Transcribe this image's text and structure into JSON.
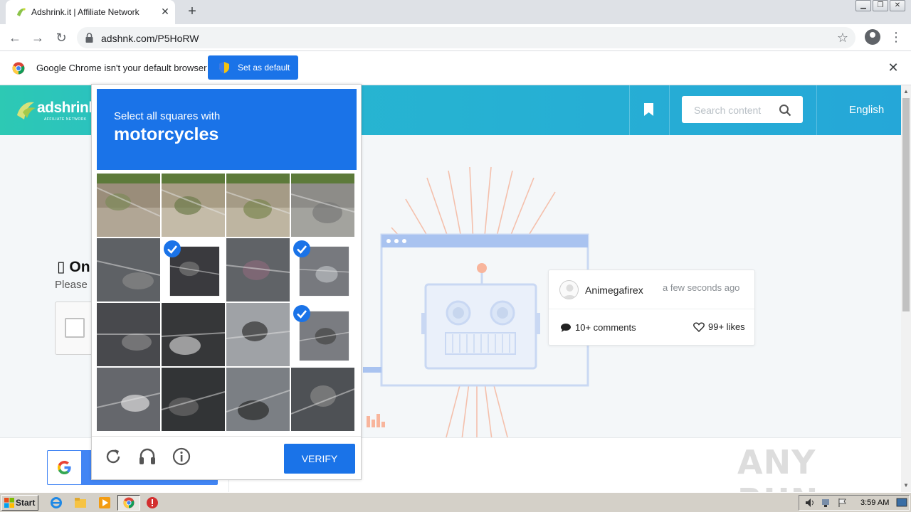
{
  "browser": {
    "tab_title": "Adshrink.it | Affiliate Network",
    "url": "adshnk.com/P5HoRW",
    "infobar_message": "Google Chrome isn't your default browser",
    "set_default_label": "Set as default"
  },
  "site": {
    "logo_text": "adshrink.it",
    "logo_sub": "AFFILIATE NETWORK",
    "search_placeholder": "Search content",
    "language": "English",
    "lead_title": "On",
    "lead_sub": "Please"
  },
  "card": {
    "author": "Animegafirex",
    "time": "a few seconds ago",
    "comments": "10+ comments",
    "likes": "99+ likes"
  },
  "captcha": {
    "instruction": "Select all squares with",
    "target": "motorcycles",
    "verify_label": "VERIFY",
    "selected_tiles": [
      5,
      7,
      11
    ]
  },
  "watermark": "ANY RUN",
  "taskbar": {
    "start_label": "Start",
    "clock": "3:59 AM"
  },
  "colors": {
    "accent": "#1a73e8",
    "header_start": "#2dc9b4",
    "header_end": "#25a7d8"
  }
}
